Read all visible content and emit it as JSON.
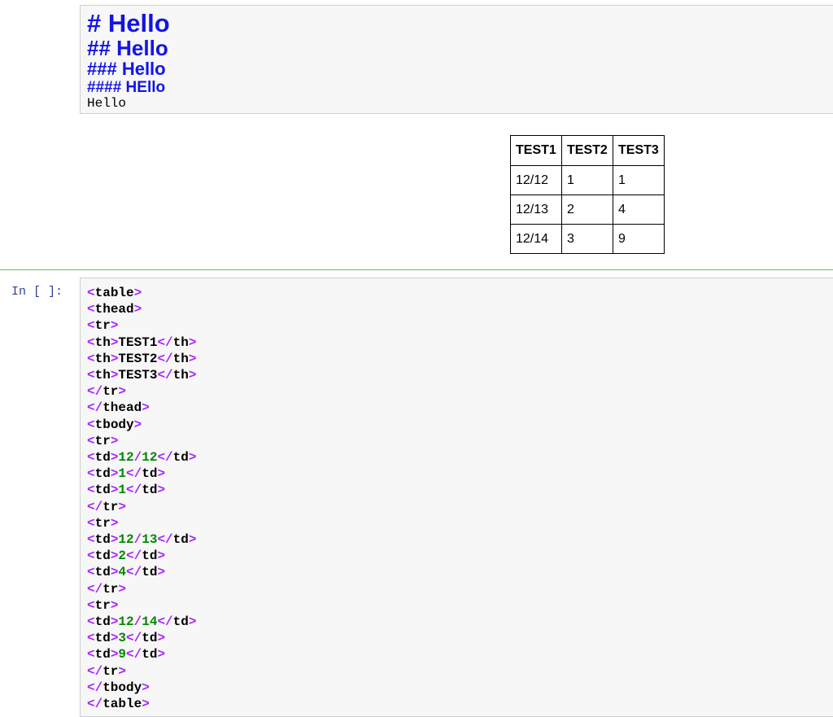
{
  "markdown": {
    "h1": "# Hello",
    "h2": "## Hello",
    "h3": "### Hello",
    "h4": "#### HEllo",
    "plain": "Hello"
  },
  "table": {
    "headers": [
      "TEST1",
      "TEST2",
      "TEST3"
    ],
    "rows": [
      [
        "12/12",
        "1",
        "1"
      ],
      [
        "12/13",
        "2",
        "4"
      ],
      [
        "12/14",
        "3",
        "9"
      ]
    ]
  },
  "code_cell": {
    "prompt": "In [ ]:",
    "lines": [
      [
        {
          "t": "<",
          "c": "tag"
        },
        {
          "t": "table",
          "c": "name"
        },
        {
          "t": ">",
          "c": "tag"
        }
      ],
      [
        {
          "t": "<",
          "c": "tag"
        },
        {
          "t": "thead",
          "c": "name"
        },
        {
          "t": ">",
          "c": "tag"
        }
      ],
      [
        {
          "t": "<",
          "c": "tag"
        },
        {
          "t": "tr",
          "c": "name"
        },
        {
          "t": ">",
          "c": "tag"
        }
      ],
      [
        {
          "t": "<",
          "c": "tag"
        },
        {
          "t": "th",
          "c": "name"
        },
        {
          "t": ">",
          "c": "tag"
        },
        {
          "t": "TEST1",
          "c": "txt"
        },
        {
          "t": "</",
          "c": "tag"
        },
        {
          "t": "th",
          "c": "name"
        },
        {
          "t": ">",
          "c": "tag"
        }
      ],
      [
        {
          "t": "<",
          "c": "tag"
        },
        {
          "t": "th",
          "c": "name"
        },
        {
          "t": ">",
          "c": "tag"
        },
        {
          "t": "TEST2",
          "c": "txt"
        },
        {
          "t": "</",
          "c": "tag"
        },
        {
          "t": "th",
          "c": "name"
        },
        {
          "t": ">",
          "c": "tag"
        }
      ],
      [
        {
          "t": "<",
          "c": "tag"
        },
        {
          "t": "th",
          "c": "name"
        },
        {
          "t": ">",
          "c": "tag"
        },
        {
          "t": "TEST3",
          "c": "txt"
        },
        {
          "t": "</",
          "c": "tag"
        },
        {
          "t": "th",
          "c": "name"
        },
        {
          "t": ">",
          "c": "tag"
        }
      ],
      [
        {
          "t": "</",
          "c": "tag"
        },
        {
          "t": "tr",
          "c": "name"
        },
        {
          "t": ">",
          "c": "tag"
        }
      ],
      [
        {
          "t": "</",
          "c": "tag"
        },
        {
          "t": "thead",
          "c": "name"
        },
        {
          "t": ">",
          "c": "tag"
        }
      ],
      [
        {
          "t": "<",
          "c": "tag"
        },
        {
          "t": "tbody",
          "c": "name"
        },
        {
          "t": ">",
          "c": "tag"
        }
      ],
      [
        {
          "t": "<",
          "c": "tag"
        },
        {
          "t": "tr",
          "c": "name"
        },
        {
          "t": ">",
          "c": "tag"
        }
      ],
      [
        {
          "t": "<",
          "c": "tag"
        },
        {
          "t": "td",
          "c": "name"
        },
        {
          "t": ">",
          "c": "tag"
        },
        {
          "t": "12",
          "c": "num"
        },
        {
          "t": "/",
          "c": "tag"
        },
        {
          "t": "12",
          "c": "num"
        },
        {
          "t": "</",
          "c": "tag"
        },
        {
          "t": "td",
          "c": "name"
        },
        {
          "t": ">",
          "c": "tag"
        }
      ],
      [
        {
          "t": "<",
          "c": "tag"
        },
        {
          "t": "td",
          "c": "name"
        },
        {
          "t": ">",
          "c": "tag"
        },
        {
          "t": "1",
          "c": "num"
        },
        {
          "t": "</",
          "c": "tag"
        },
        {
          "t": "td",
          "c": "name"
        },
        {
          "t": ">",
          "c": "tag"
        }
      ],
      [
        {
          "t": "<",
          "c": "tag"
        },
        {
          "t": "td",
          "c": "name"
        },
        {
          "t": ">",
          "c": "tag"
        },
        {
          "t": "1",
          "c": "num"
        },
        {
          "t": "</",
          "c": "tag"
        },
        {
          "t": "td",
          "c": "name"
        },
        {
          "t": ">",
          "c": "tag"
        }
      ],
      [
        {
          "t": "</",
          "c": "tag"
        },
        {
          "t": "tr",
          "c": "name"
        },
        {
          "t": ">",
          "c": "tag"
        }
      ],
      [
        {
          "t": "<",
          "c": "tag"
        },
        {
          "t": "tr",
          "c": "name"
        },
        {
          "t": ">",
          "c": "tag"
        }
      ],
      [
        {
          "t": "<",
          "c": "tag"
        },
        {
          "t": "td",
          "c": "name"
        },
        {
          "t": ">",
          "c": "tag"
        },
        {
          "t": "12",
          "c": "num"
        },
        {
          "t": "/",
          "c": "tag"
        },
        {
          "t": "13",
          "c": "num"
        },
        {
          "t": "</",
          "c": "tag"
        },
        {
          "t": "td",
          "c": "name"
        },
        {
          "t": ">",
          "c": "tag"
        }
      ],
      [
        {
          "t": "<",
          "c": "tag"
        },
        {
          "t": "td",
          "c": "name"
        },
        {
          "t": ">",
          "c": "tag"
        },
        {
          "t": "2",
          "c": "num"
        },
        {
          "t": "</",
          "c": "tag"
        },
        {
          "t": "td",
          "c": "name"
        },
        {
          "t": ">",
          "c": "tag"
        }
      ],
      [
        {
          "t": "<",
          "c": "tag"
        },
        {
          "t": "td",
          "c": "name"
        },
        {
          "t": ">",
          "c": "tag"
        },
        {
          "t": "4",
          "c": "num"
        },
        {
          "t": "</",
          "c": "tag"
        },
        {
          "t": "td",
          "c": "name"
        },
        {
          "t": ">",
          "c": "tag"
        }
      ],
      [
        {
          "t": "</",
          "c": "tag"
        },
        {
          "t": "tr",
          "c": "name"
        },
        {
          "t": ">",
          "c": "tag"
        }
      ],
      [
        {
          "t": "<",
          "c": "tag"
        },
        {
          "t": "tr",
          "c": "name"
        },
        {
          "t": ">",
          "c": "tag"
        }
      ],
      [
        {
          "t": "<",
          "c": "tag"
        },
        {
          "t": "td",
          "c": "name"
        },
        {
          "t": ">",
          "c": "tag"
        },
        {
          "t": "12",
          "c": "num"
        },
        {
          "t": "/",
          "c": "tag"
        },
        {
          "t": "14",
          "c": "num"
        },
        {
          "t": "</",
          "c": "tag"
        },
        {
          "t": "td",
          "c": "name"
        },
        {
          "t": ">",
          "c": "tag"
        }
      ],
      [
        {
          "t": "<",
          "c": "tag"
        },
        {
          "t": "td",
          "c": "name"
        },
        {
          "t": ">",
          "c": "tag"
        },
        {
          "t": "3",
          "c": "num"
        },
        {
          "t": "</",
          "c": "tag"
        },
        {
          "t": "td",
          "c": "name"
        },
        {
          "t": ">",
          "c": "tag"
        }
      ],
      [
        {
          "t": "<",
          "c": "tag"
        },
        {
          "t": "td",
          "c": "name"
        },
        {
          "t": ">",
          "c": "tag"
        },
        {
          "t": "9",
          "c": "num"
        },
        {
          "t": "</",
          "c": "tag"
        },
        {
          "t": "td",
          "c": "name"
        },
        {
          "t": ">",
          "c": "tag"
        }
      ],
      [
        {
          "t": "</",
          "c": "tag"
        },
        {
          "t": "tr",
          "c": "name"
        },
        {
          "t": ">",
          "c": "tag"
        }
      ],
      [
        {
          "t": "</",
          "c": "tag"
        },
        {
          "t": "tbody",
          "c": "name"
        },
        {
          "t": ">",
          "c": "tag"
        }
      ],
      [
        {
          "t": "</",
          "c": "tag"
        },
        {
          "t": "table",
          "c": "name"
        },
        {
          "t": ">",
          "c": "tag"
        }
      ]
    ]
  },
  "colors": {
    "heading": "#1414e6",
    "tag": "#aa22ff",
    "number": "#008800",
    "prompt": "#303f9f",
    "active_cell_border": "#66bb6a"
  }
}
